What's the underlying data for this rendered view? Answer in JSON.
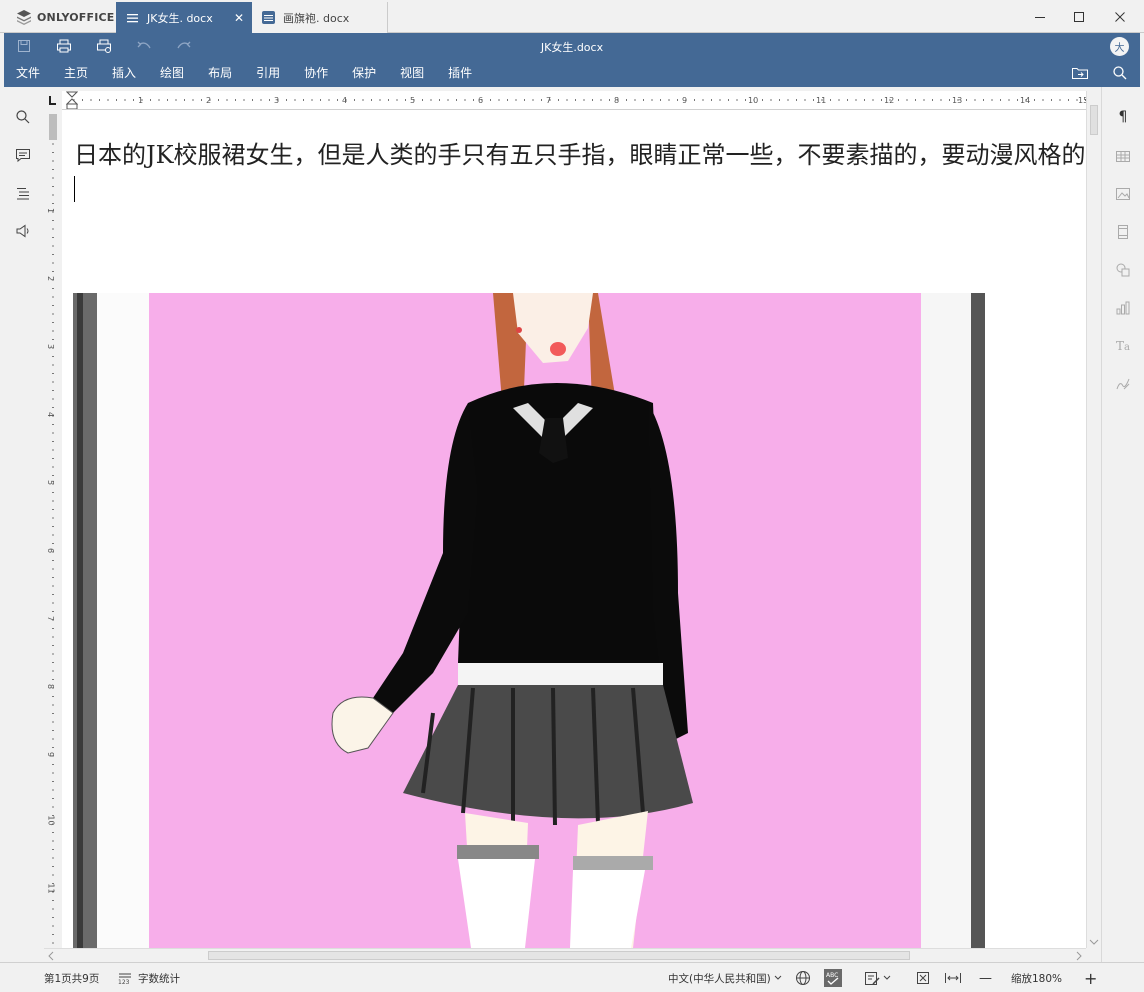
{
  "app": {
    "name": "ONLYOFFICE"
  },
  "tabs": [
    {
      "label": "JK女生. docx",
      "active": true,
      "close": "✕"
    },
    {
      "label": "画旗袍. docx",
      "active": false
    }
  ],
  "window_controls": {
    "minimize": "—",
    "maximize": "☐",
    "close": "✕"
  },
  "header": {
    "title": "JK女生.docx",
    "avatar": "大",
    "menu": [
      "文件",
      "主页",
      "插入",
      "绘图",
      "布局",
      "引用",
      "协作",
      "保护",
      "视图",
      "插件"
    ]
  },
  "ruler": {
    "h_numbers": [
      "1",
      "2",
      "3",
      "4",
      "5",
      "6",
      "7",
      "8",
      "9",
      "10",
      "11",
      "12",
      "13",
      "14",
      "15"
    ],
    "v_numbers": [
      "1",
      "2",
      "3",
      "4",
      "5",
      "6",
      "7",
      "8",
      "9",
      "10",
      "11"
    ]
  },
  "document": {
    "text": "日本的JK校服裙女生，但是人类的手只有五只手指，眼睛正常一些，不要素描的，要动漫风格的",
    "image_alt": "anime schoolgirl illustration"
  },
  "status": {
    "page": "第1页共9页",
    "word_count": "字数统计",
    "language": "中文(中华人民共和国)",
    "zoom": "缩放180%",
    "zoom_minus": "—",
    "zoom_plus": "+"
  },
  "colors": {
    "accent": "#446995",
    "image_bg": "#f7aeea"
  }
}
